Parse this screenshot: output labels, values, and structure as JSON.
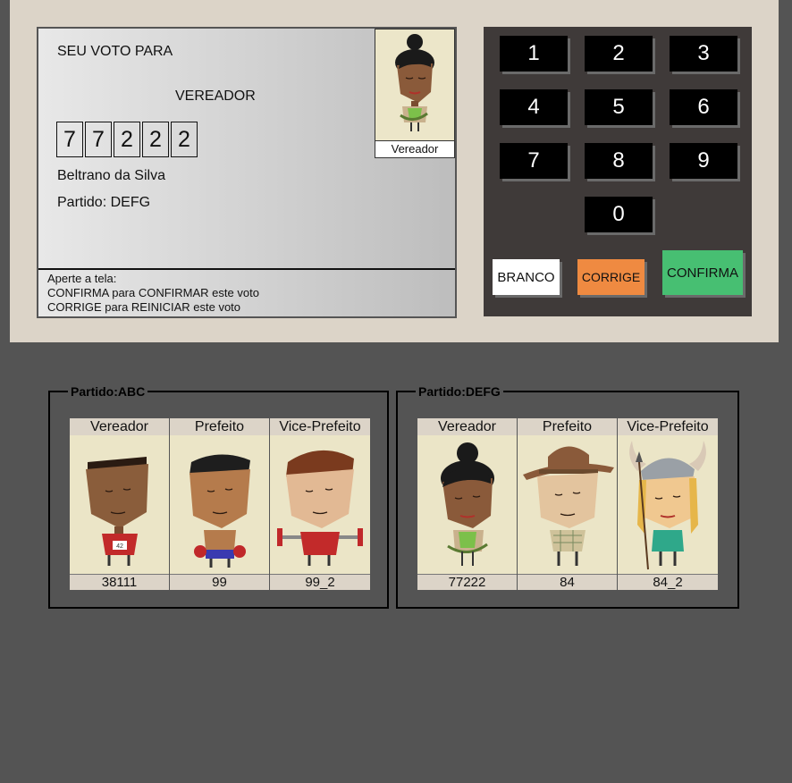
{
  "urna": {
    "screen": {
      "seu_voto": "SEU VOTO PARA",
      "cargo": "VEREADOR",
      "digits": [
        "7",
        "7",
        "2",
        "2",
        "2"
      ],
      "candidate_name": "Beltrano da Silva",
      "candidate_party": "Partido: DEFG",
      "photo_caption": "Vereador",
      "instructions": [
        "Aperte a tela:",
        "CONFIRMA para CONFIRMAR este voto",
        "CORRIGE para REINICIAR este voto"
      ]
    },
    "keypad": {
      "keys": [
        "1",
        "2",
        "3",
        "4",
        "5",
        "6",
        "7",
        "8",
        "9",
        "0"
      ],
      "branco_label": "BRANCO",
      "corrige_label": "CORRIGE",
      "confirma_label": "CONFIRMA"
    },
    "colors": {
      "branco": "#ffffff",
      "corrige": "#ef8a41",
      "confirma": "#47bf72"
    }
  },
  "parties": [
    {
      "legend": "Partido:ABC",
      "candidates": [
        {
          "role": "Vereador",
          "number": "38111",
          "avatar": "runner-man-avatar"
        },
        {
          "role": "Prefeito",
          "number": "99",
          "avatar": "boxer-man-avatar"
        },
        {
          "role": "Vice-Prefeito",
          "number": "99_2",
          "avatar": "weightlifter-man-avatar"
        }
      ]
    },
    {
      "legend": "Partido:DEFG",
      "candidates": [
        {
          "role": "Vereador",
          "number": "77222",
          "avatar": "woman-with-snake-avatar"
        },
        {
          "role": "Prefeito",
          "number": "84",
          "avatar": "cowboy-man-avatar"
        },
        {
          "role": "Vice-Prefeito",
          "number": "84_2",
          "avatar": "viking-woman-avatar"
        }
      ]
    }
  ]
}
